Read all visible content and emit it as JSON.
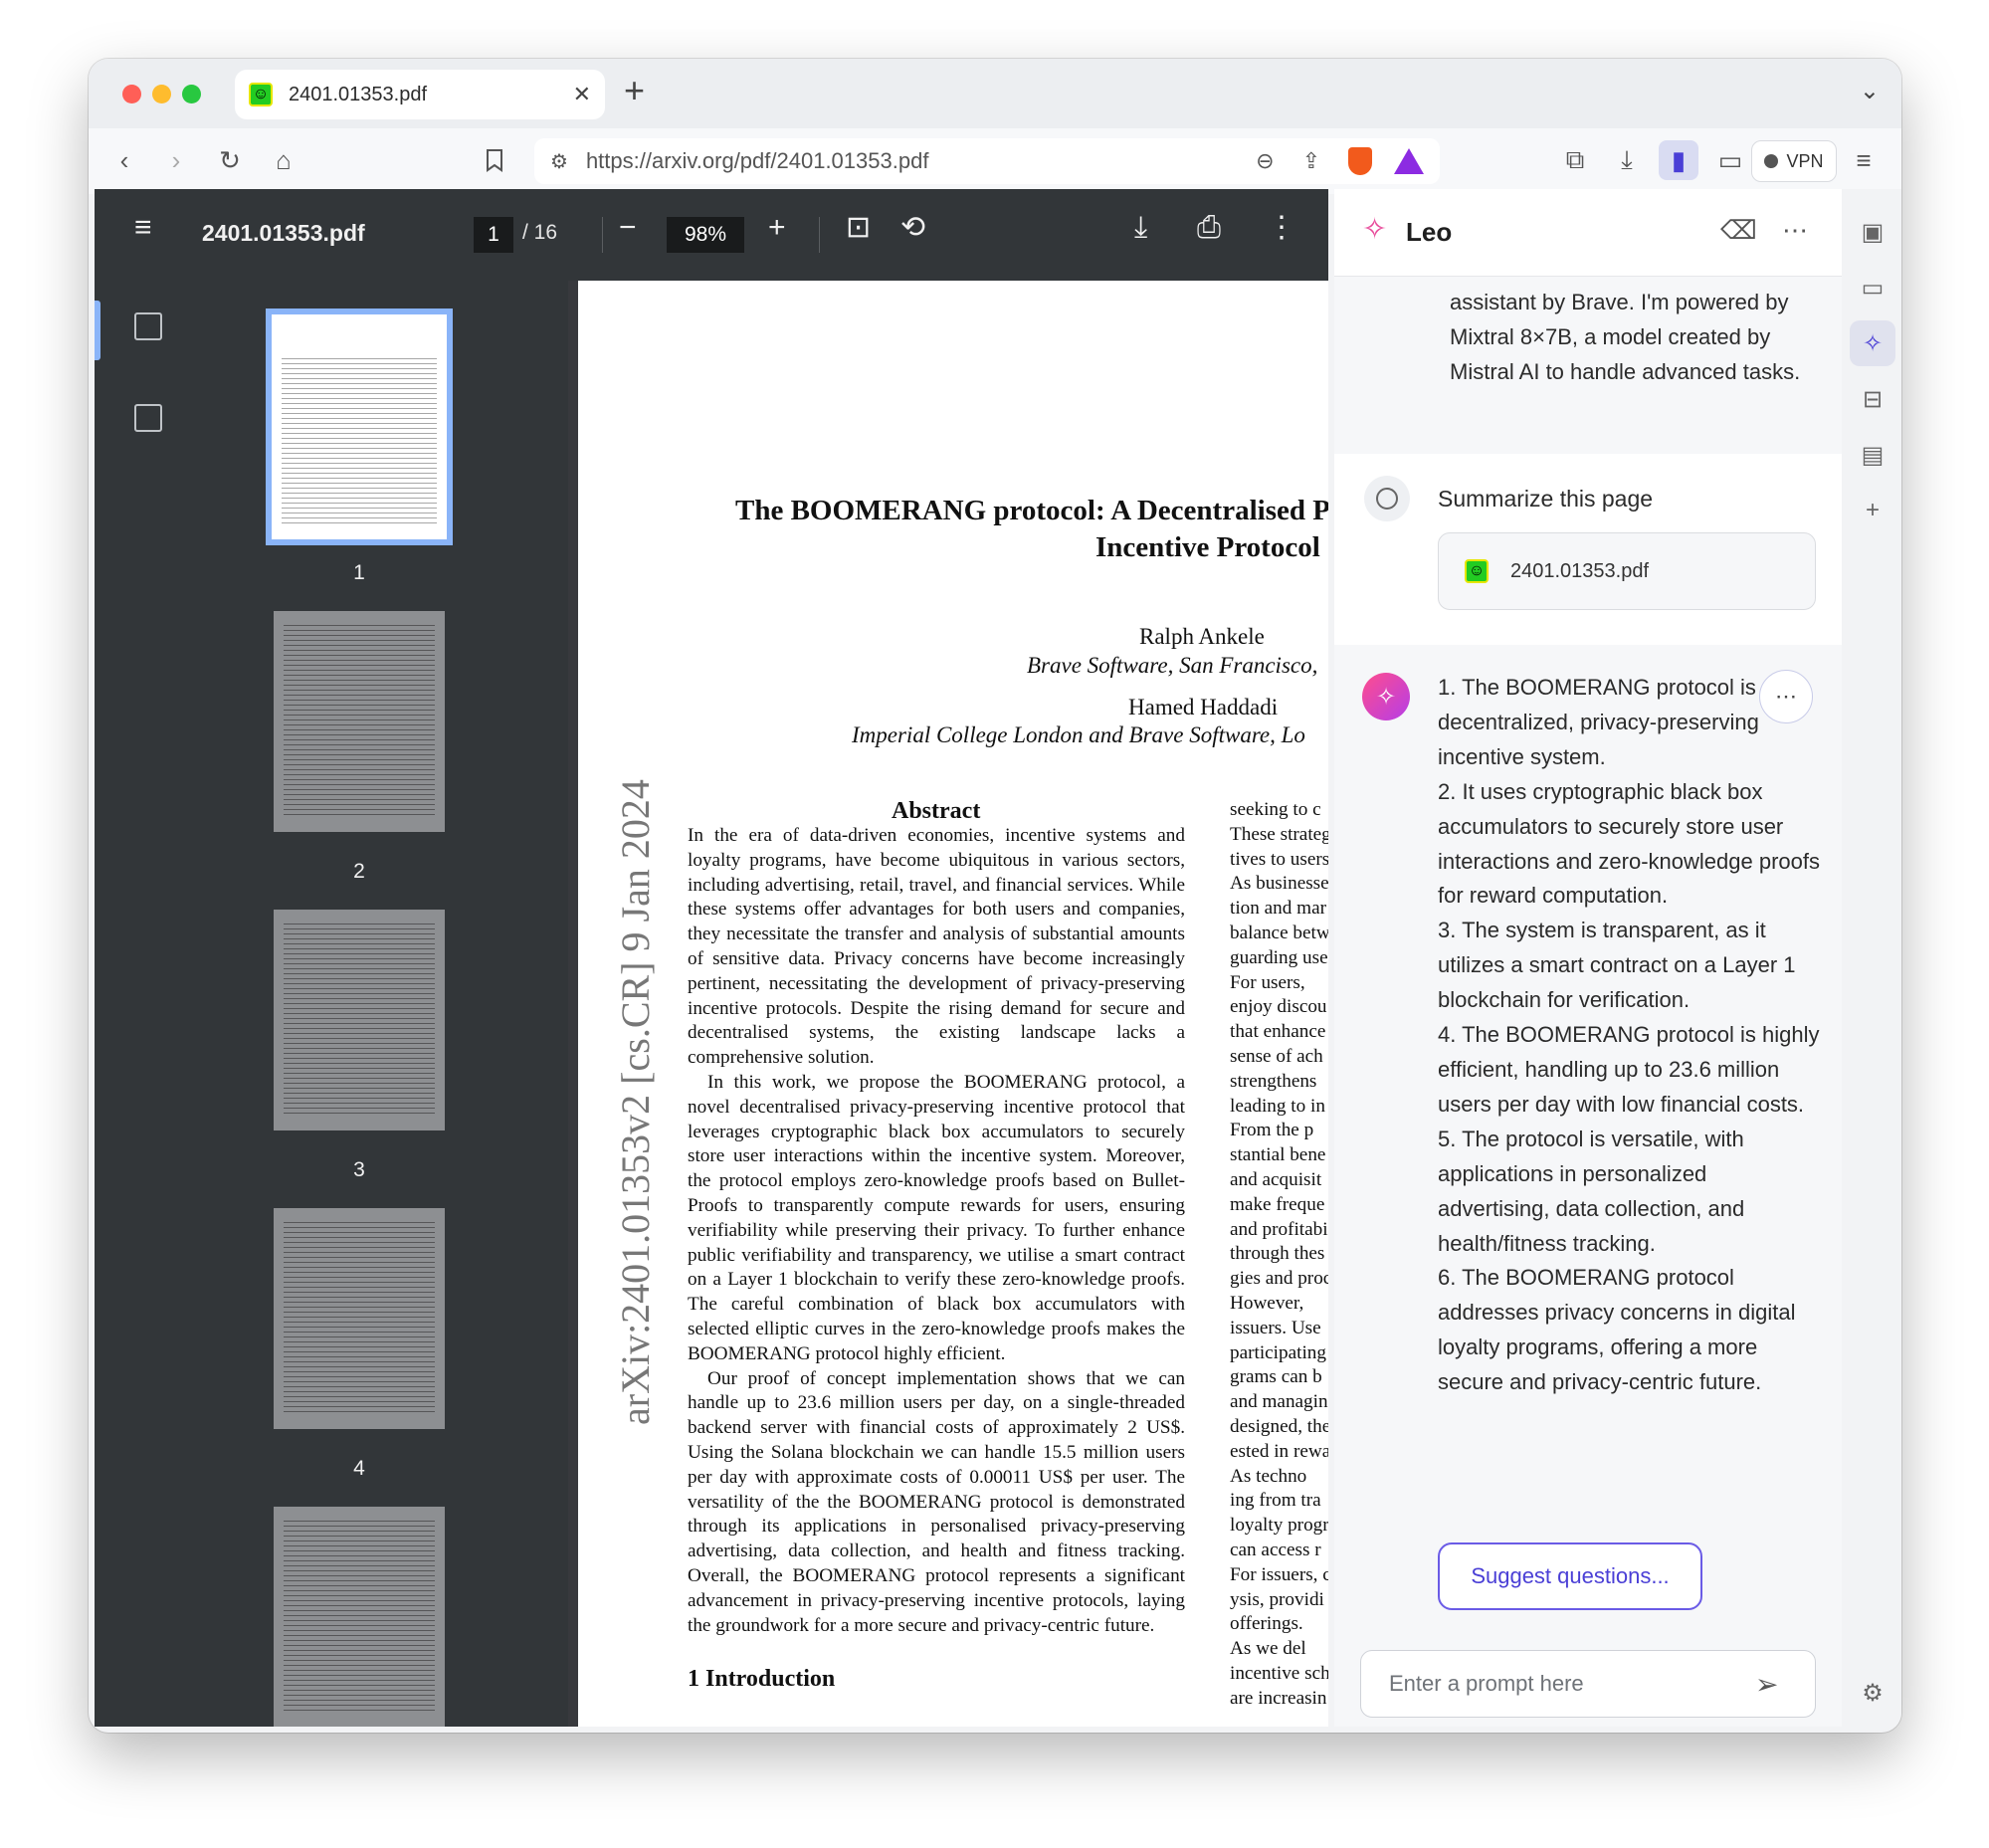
{
  "browser": {
    "tab": {
      "title": "2401.01353.pdf",
      "favicon": "smiley-favicon-icon"
    },
    "url": "https://arxiv.org/pdf/2401.01353.pdf",
    "vpn_label": "VPN"
  },
  "pdf_viewer": {
    "file_name": "2401.01353.pdf",
    "current_page": "1",
    "total_pages": "/ 16",
    "zoom": "98%",
    "thumbnails": [
      "1",
      "2",
      "3",
      "4"
    ]
  },
  "paper": {
    "title_line1": "The BOOMERANG protocol: A Decentralised Pr",
    "title_line2": "Incentive Protocol",
    "author1": "Ralph Ankele",
    "affil1": "Brave Software, San Francisco,",
    "author2": "Hamed Haddadi",
    "affil2": "Imperial College London and Brave Software, Lo",
    "arxiv_id": "arXiv:2401.01353v2  [cs.CR]  9 Jan 2024",
    "abstract_heading": "Abstract",
    "abstract_p1": "In the era of data-driven economies, incentive systems and loyalty programs, have become ubiquitous in various sectors, including advertising, retail, travel, and financial services. While these systems offer advantages for both users and companies, they necessitate the transfer and analysis of substantial amounts of sensitive data. Privacy concerns have become increasingly pertinent, necessitating the development of privacy-preserving incentive protocols. Despite the rising demand for secure and decentralised systems, the existing landscape lacks a comprehensive solution.",
    "abstract_p2": "In this work, we propose the BOOMERANG protocol, a novel decentralised privacy-preserving incentive protocol that leverages cryptographic black box accumulators to securely store user interactions within the incentive system. Moreover, the protocol employs zero-knowledge proofs based on Bullet-Proofs to transparently compute rewards for users, ensuring verifiability while preserving their privacy. To further enhance public verifiability and transparency, we utilise a smart contract on a Layer 1 blockchain to verify these zero-knowledge proofs. The careful combination of black box accumulators with selected elliptic curves in the zero-knowledge proofs makes the BOOMERANG protocol highly efficient.",
    "abstract_p3": "Our proof of concept implementation shows that we can handle up to 23.6 million users per day, on a single-threaded backend server with financial costs of approximately 2 US$. Using the Solana blockchain we can handle 15.5 million users per day with approximate costs of 0.00011 US$ per user. The versatility of the the BOOMERANG protocol is demonstrated through its applications in personalised privacy-preserving advertising, data collection, and health and fitness tracking. Overall, the BOOMERANG protocol represents a significant advancement in privacy-preserving incentive protocols, laying the groundwork for a more secure and privacy-centric future.",
    "col2_lines": [
      "seeking to c",
      "These strateg",
      "tives to users",
      "As businesse",
      "tion and mar",
      "balance betw",
      "guarding use",
      "   For users,",
      "enjoy discou",
      "that enhance",
      "sense of ach",
      "strengthens",
      "leading to in",
      "   From the p",
      "stantial bene",
      "and acquisit",
      "make freque",
      "and profitabi",
      "through thes",
      "gies and proc",
      "   However,",
      "issuers. Use",
      "participating",
      "grams can b",
      "and managin",
      "designed, the",
      "ested in rewa",
      "   As techno",
      "ing from tra",
      "loyalty progr",
      "can access r",
      "For issuers, c",
      "ysis, providi",
      "offerings.",
      "   As we del",
      "incentive sch",
      "are increasin"
    ],
    "intro_heading": "1    Introduction"
  },
  "leo": {
    "title": "Leo",
    "intro_text": "assistant by Brave. I'm powered by Mixtral 8×7B, a model created by Mistral AI to handle advanced tasks.",
    "user_message": "Summarize this page",
    "attachment_name": "2401.01353.pdf",
    "reply_items": [
      "1. The BOOMERANG protocol is a decentralized, privacy-preserving incentive system.",
      "2. It uses cryptographic black box accumulators to securely store user interactions and zero-knowledge proofs for reward computation.",
      "3. The system is transparent, as it utilizes a smart contract on a Layer 1 blockchain for verification.",
      "4. The BOOMERANG protocol is highly efficient, handling up to 23.6 million users per day with low financial costs.",
      "5. The protocol is versatile, with applications in personalized advertising, data collection, and health/fitness tracking.",
      "6. The BOOMERANG protocol addresses privacy concerns in digital loyalty programs, offering a more secure and privacy-centric future."
    ],
    "suggest_label": "Suggest questions...",
    "prompt_placeholder": "Enter a prompt here"
  },
  "colors": {
    "accent": "#4a3fd6",
    "leo_pink": "#e84a9a",
    "brave_orange": "#f25a1c",
    "pdf_toolbar": "#323639"
  }
}
